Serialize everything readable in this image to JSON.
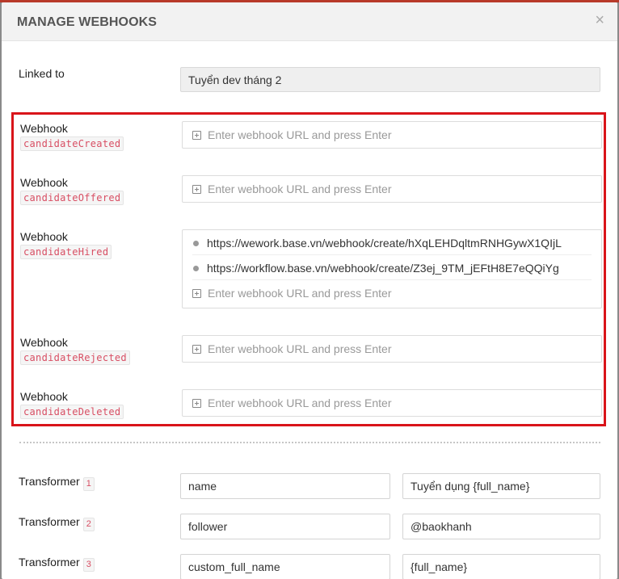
{
  "modal": {
    "title": "MANAGE WEBHOOKS",
    "close_label": "×"
  },
  "linked": {
    "label": "Linked to",
    "value": "Tuyển dev tháng 2"
  },
  "webhook_placeholder": "Enter webhook URL and press Enter",
  "webhooks": [
    {
      "title": "Webhook",
      "event": "candidateCreated",
      "urls": []
    },
    {
      "title": "Webhook",
      "event": "candidateOffered",
      "urls": []
    },
    {
      "title": "Webhook",
      "event": "candidateHired",
      "urls": [
        "https://wework.base.vn/webhook/create/hXqLEHDqltmRNHGywX1QIjL",
        "https://workflow.base.vn/webhook/create/Z3ej_9TM_jEFtH8E7eQQiYg"
      ]
    },
    {
      "title": "Webhook",
      "event": "candidateRejected",
      "urls": []
    },
    {
      "title": "Webhook",
      "event": "candidateDeleted",
      "urls": []
    }
  ],
  "transformers": [
    {
      "label": "Transformer",
      "index": "1",
      "key": "name",
      "value": "Tuyển dụng {full_name}"
    },
    {
      "label": "Transformer",
      "index": "2",
      "key": "follower",
      "value": "@baokhanh"
    },
    {
      "label": "Transformer",
      "index": "3",
      "key": "custom_full_name",
      "value": "{full_name}"
    }
  ],
  "colors": {
    "highlight_border": "#d9141a",
    "code_text": "#d84e63"
  }
}
